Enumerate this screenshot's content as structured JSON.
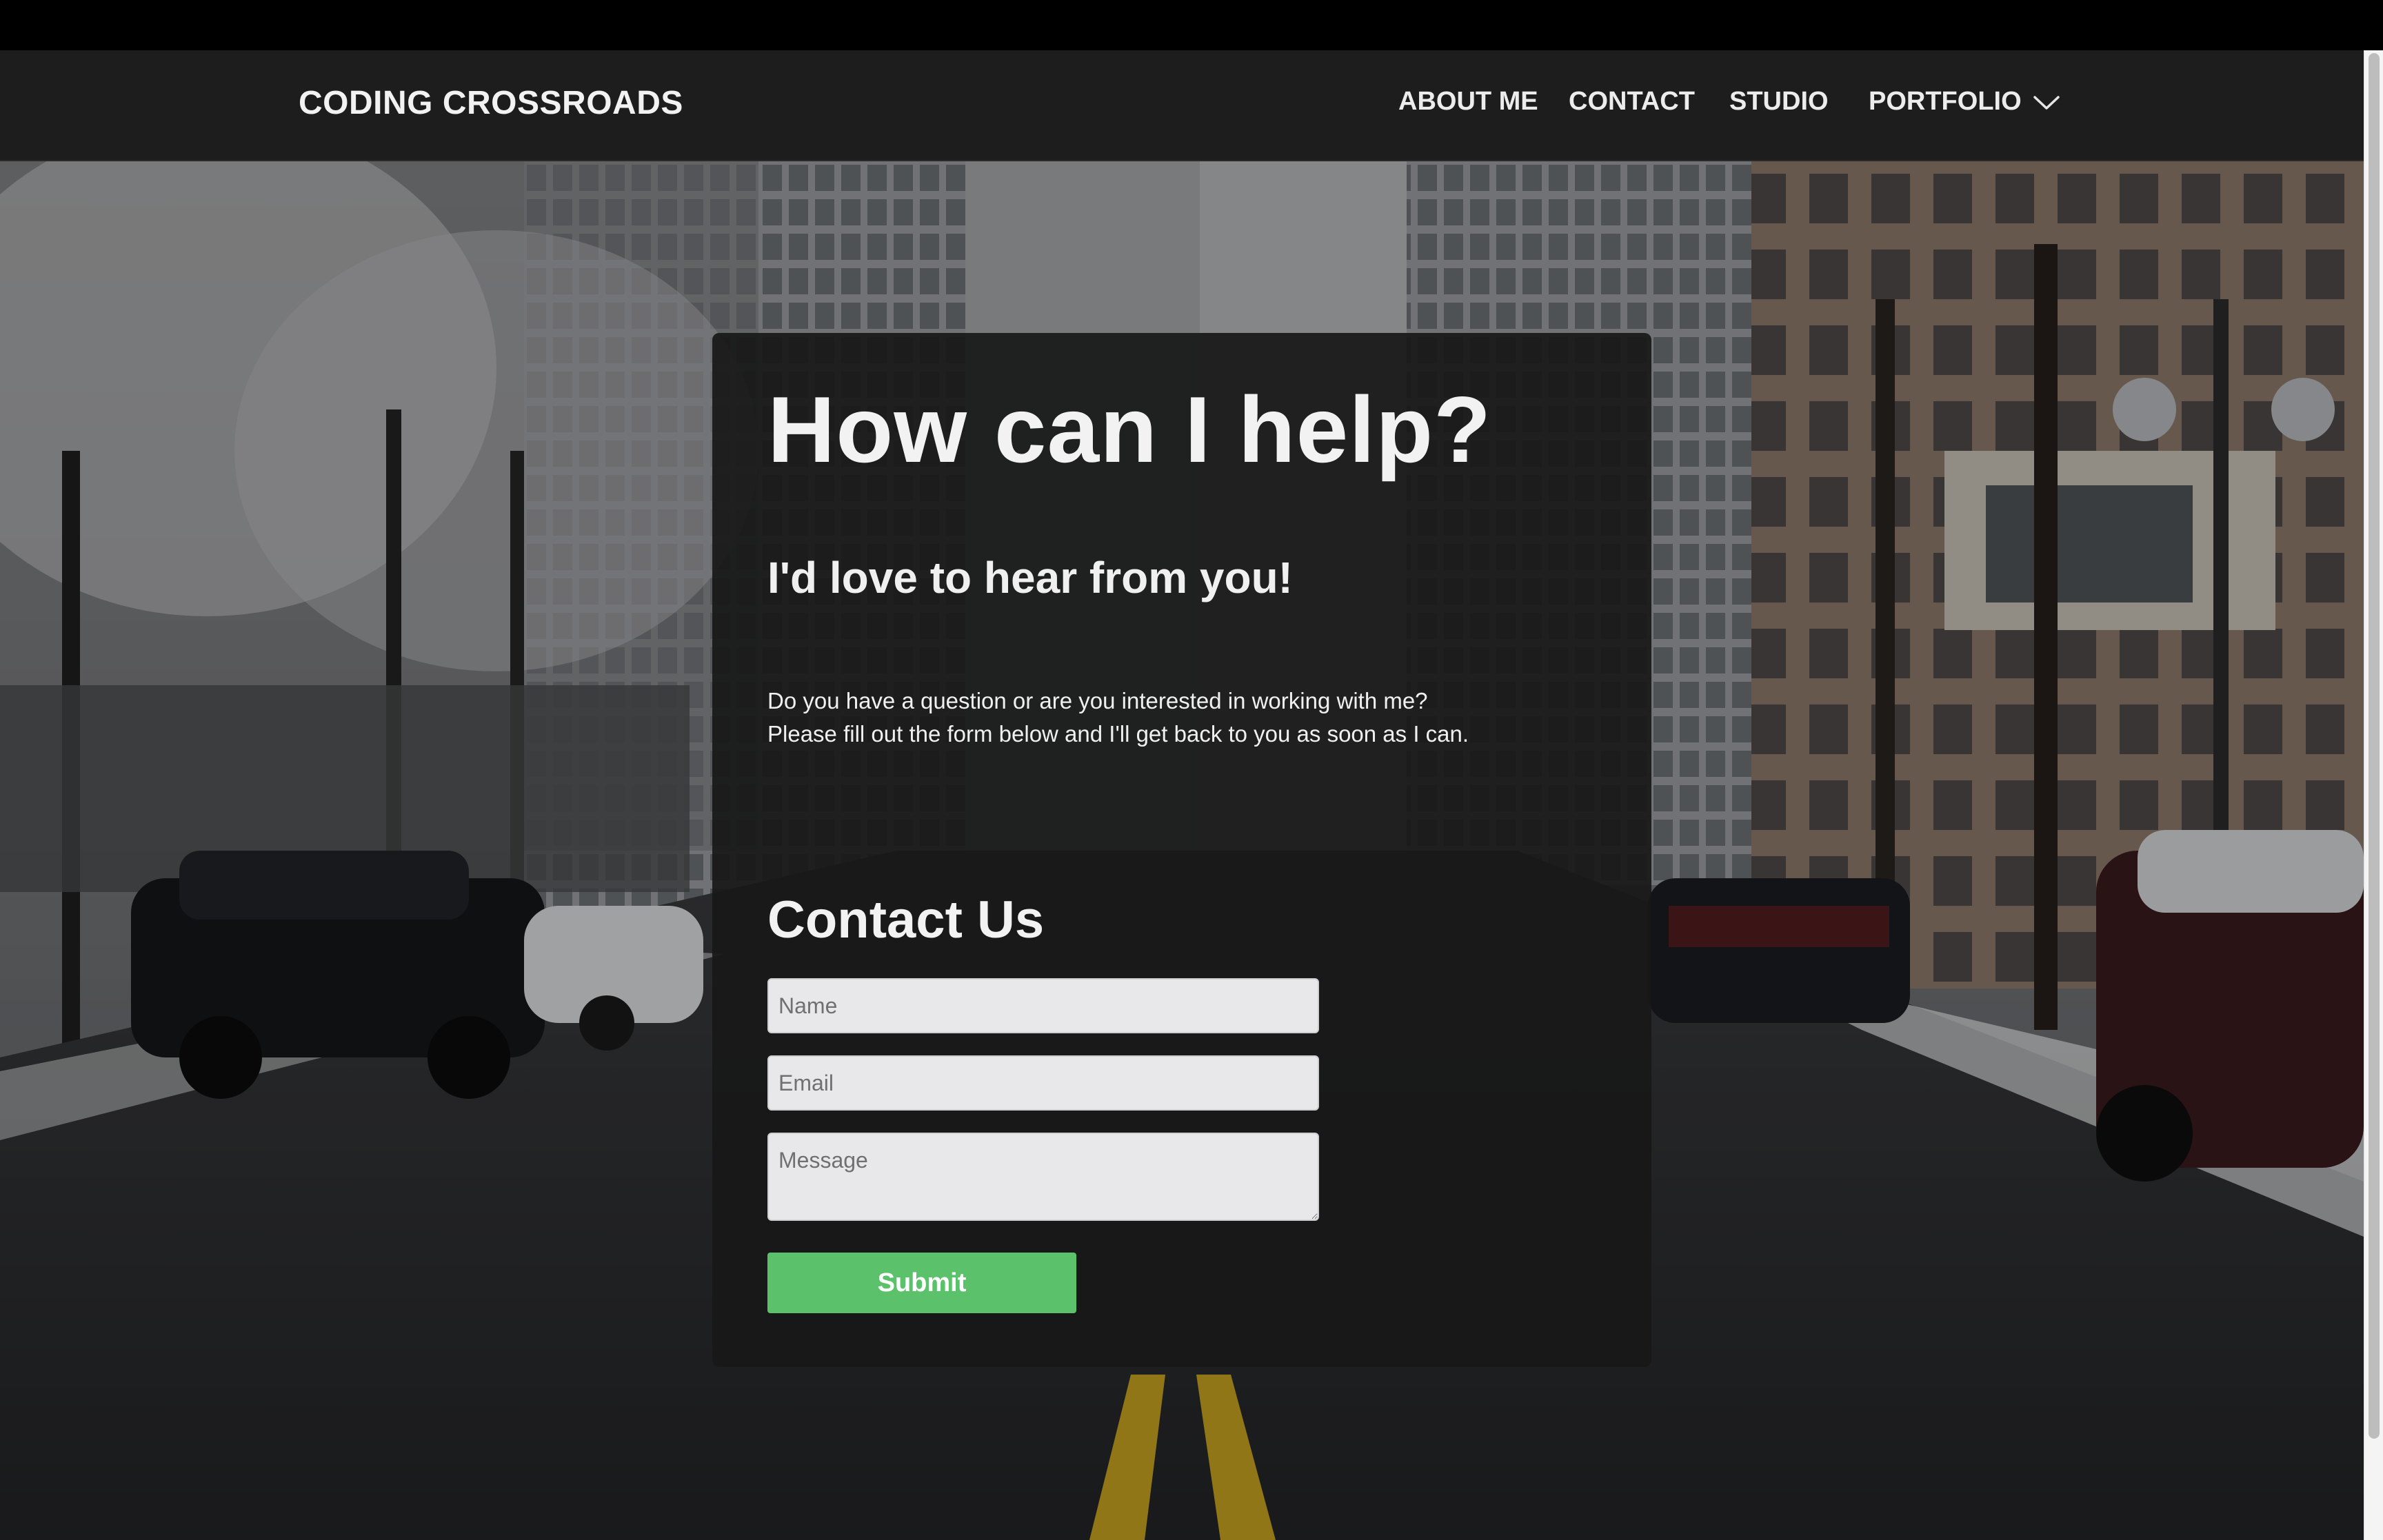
{
  "header": {
    "brand": "CODING CROSSROADS",
    "nav": [
      {
        "label": "ABOUT ME"
      },
      {
        "label": "CONTACT"
      },
      {
        "label": "STUDIO"
      },
      {
        "label": "PORTFOLIO"
      }
    ],
    "dropdown_icon": "chevron-down-icon"
  },
  "hero": {
    "title": "How can I help?",
    "subtitle": "I'd love to hear from you!",
    "intro": "Do you have a question or are you interested in working with me? Please fill out the form below and I'll get back to you as soon as I can.",
    "background": "snowy-city-street-photo"
  },
  "form": {
    "title": "Contact Us",
    "name_placeholder": "Name",
    "email_placeholder": "Email",
    "message_placeholder": "Message",
    "submit_label": "Submit"
  },
  "colors": {
    "navbar_bg": "#1d1d1d",
    "card_bg": "#181818",
    "submit_bg": "#5bc26b",
    "field_bg": "#e8e8ea"
  }
}
